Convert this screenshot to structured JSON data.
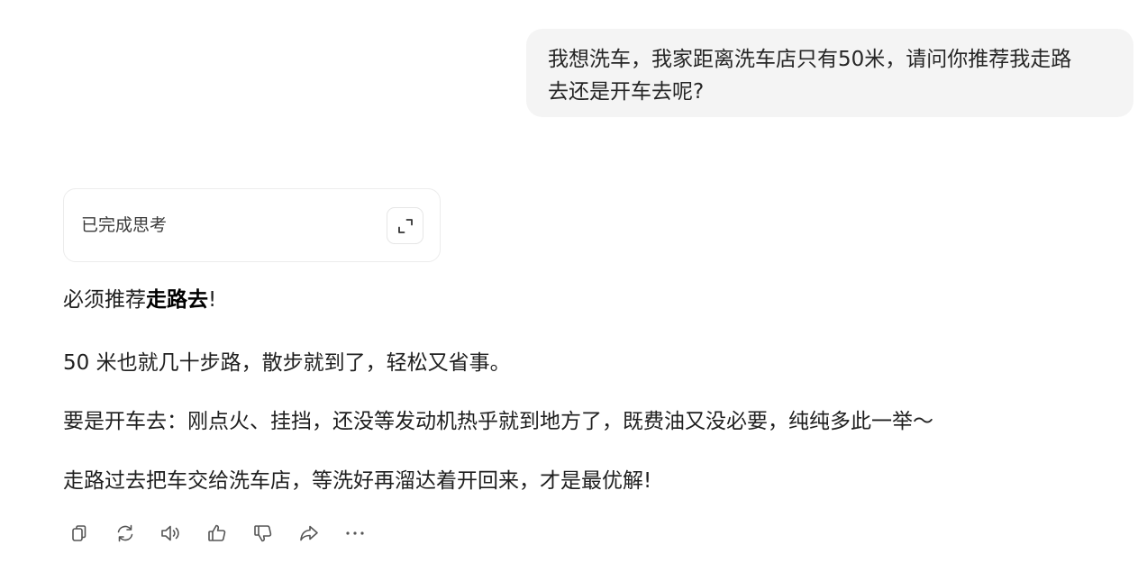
{
  "user_message": {
    "line1": "我想洗车，我家距离洗车店只有50米，请问你推荐我走路",
    "line2": "去还是开车去呢?"
  },
  "thinking": {
    "label": "已完成思考",
    "expand_icon": "expand-icon"
  },
  "answer": {
    "p1_prefix": "必须推荐",
    "p1_bold": "走路去",
    "p1_suffix": "!",
    "p2": "50 米也就几十步路，散步就到了，轻松又省事。",
    "p3": "要是开车去：刚点火、挂挡，还没等发动机热乎就到地方了，既费油又没必要，纯纯多此一举～",
    "p4": "走路过去把车交给洗车店，等洗好再溜达着开回来，才是最优解!"
  },
  "actions": [
    {
      "name": "copy",
      "icon": "copy-icon"
    },
    {
      "name": "regenerate",
      "icon": "refresh-icon"
    },
    {
      "name": "read-aloud",
      "icon": "speaker-icon"
    },
    {
      "name": "like",
      "icon": "thumbs-up-icon"
    },
    {
      "name": "dislike",
      "icon": "thumbs-down-icon"
    },
    {
      "name": "share",
      "icon": "share-icon"
    },
    {
      "name": "more",
      "icon": "more-icon"
    }
  ]
}
